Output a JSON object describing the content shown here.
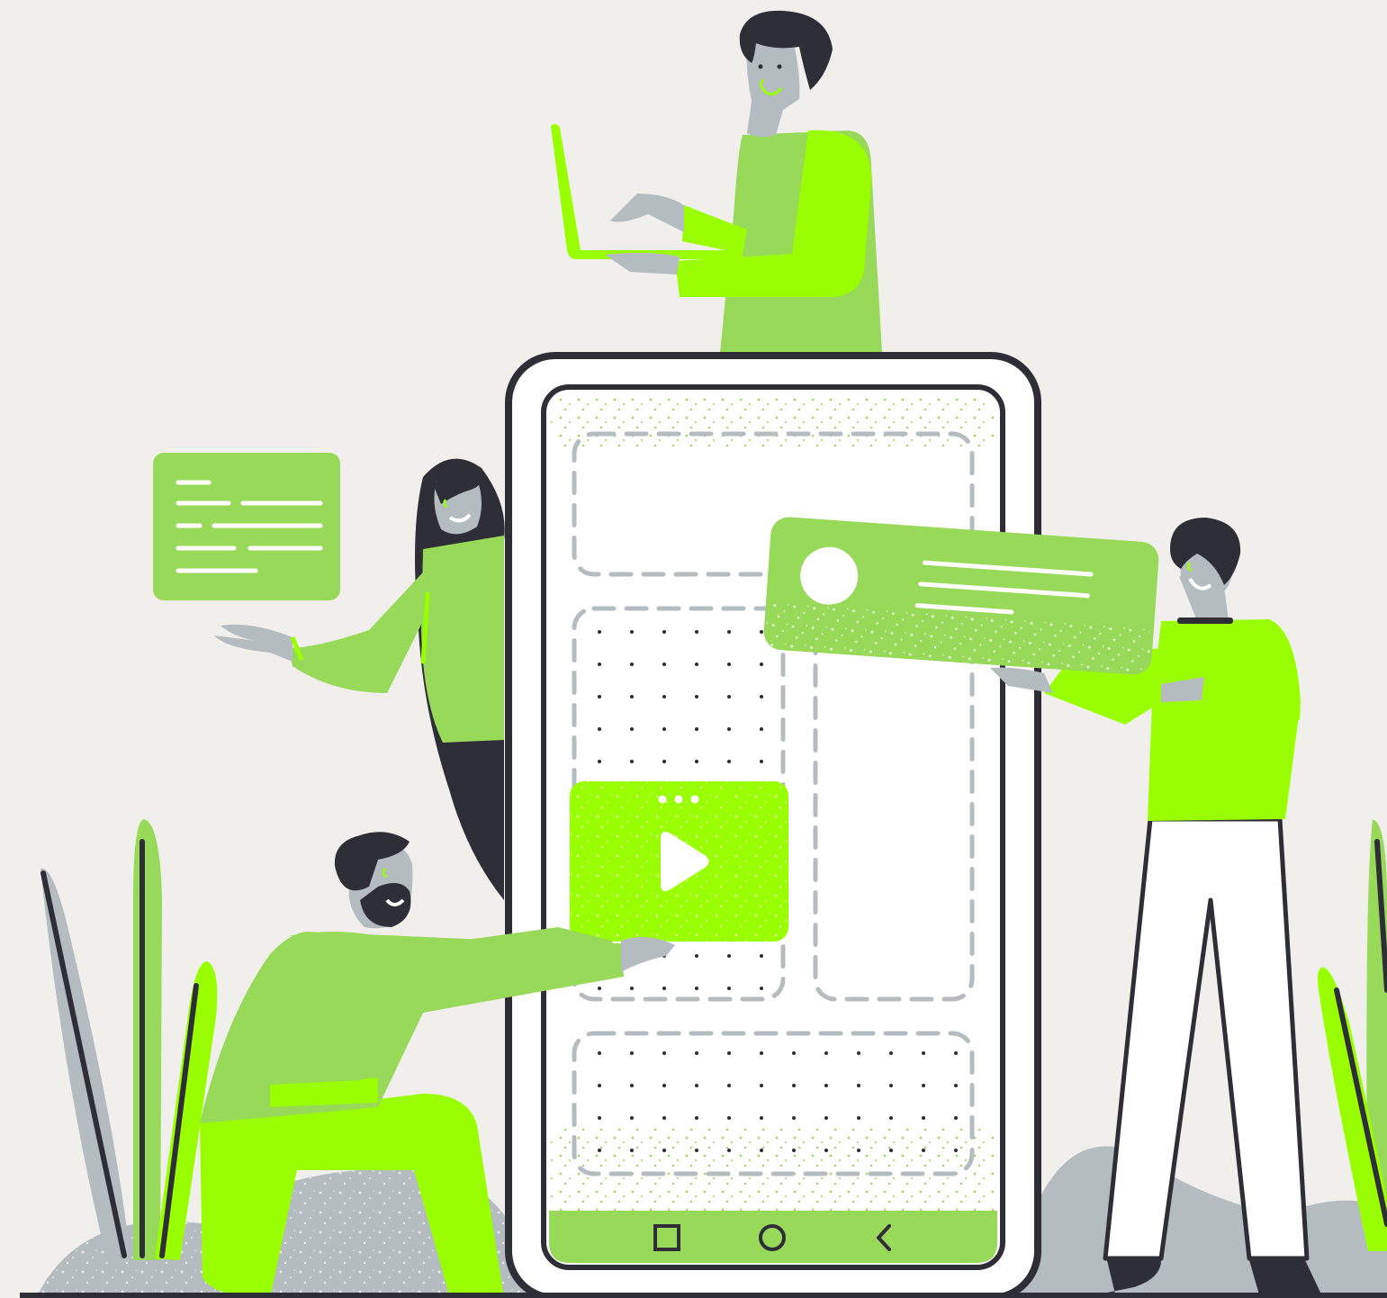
{
  "colors": {
    "background": "#F0EFEB",
    "lime": "#99FF00",
    "green": "#98D95A",
    "dark": "#2E2E36",
    "gray": "#B4BCC0",
    "white": "#FFFFFF"
  },
  "phone": {
    "nav_buttons": [
      {
        "icon": "square-nav-icon"
      },
      {
        "icon": "circle-nav-icon"
      },
      {
        "icon": "back-chevron-icon"
      }
    ],
    "video_card": {
      "icon": "play-icon"
    }
  },
  "people": [
    {
      "name": "person-typing-on-laptop"
    },
    {
      "name": "woman-presenting-text-card"
    },
    {
      "name": "man-kneeling-with-video-card"
    },
    {
      "name": "man-holding-profile-card"
    }
  ]
}
